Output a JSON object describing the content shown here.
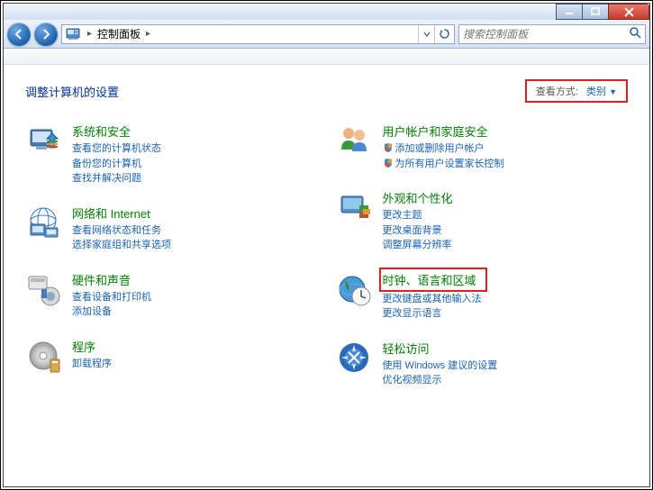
{
  "breadcrumb": {
    "item": "控制面板"
  },
  "search": {
    "placeholder": "搜索控制面板"
  },
  "heading": "调整计算机的设置",
  "viewBy": {
    "label": "查看方式:",
    "value": "类别"
  },
  "categories": {
    "left": [
      {
        "title": "系统和安全",
        "links": [
          "查看您的计算机状态",
          "备份您的计算机",
          "查找并解决问题"
        ],
        "highlight": false
      },
      {
        "title": "网络和 Internet",
        "links": [
          "查看网络状态和任务",
          "选择家庭组和共享选项"
        ],
        "highlight": false
      },
      {
        "title": "硬件和声音",
        "links": [
          "查看设备和打印机",
          "添加设备"
        ],
        "highlight": false
      },
      {
        "title": "程序",
        "links": [
          "卸载程序"
        ],
        "highlight": false
      }
    ],
    "right": [
      {
        "title": "用户帐户和家庭安全",
        "links": [
          "添加或删除用户帐户",
          "为所有用户设置家长控制"
        ],
        "shield": [
          true,
          true
        ],
        "highlight": false
      },
      {
        "title": "外观和个性化",
        "links": [
          "更改主题",
          "更改桌面背景",
          "调整屏幕分辨率"
        ],
        "highlight": false
      },
      {
        "title": "时钟、语言和区域",
        "links": [
          "更改键盘或其他输入法",
          "更改显示语言"
        ],
        "highlight": true
      },
      {
        "title": "轻松访问",
        "links": [
          "使用 Windows 建议的设置",
          "优化视频显示"
        ],
        "highlight": false
      }
    ]
  }
}
